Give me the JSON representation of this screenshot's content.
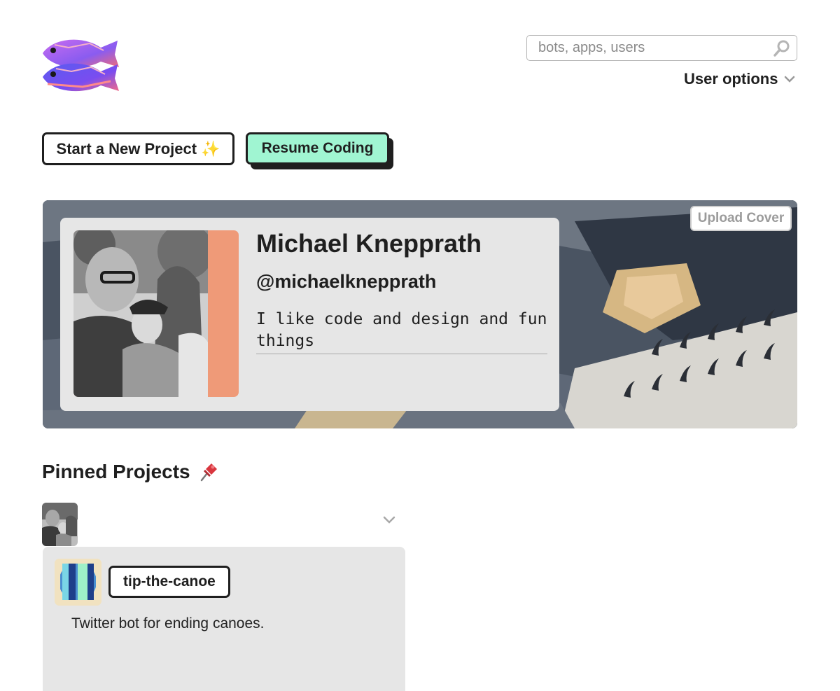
{
  "header": {
    "logo_icon": "fish-logo-icon",
    "search": {
      "placeholder": "bots, apps, users",
      "value": "",
      "icon": "search-icon"
    },
    "user_options_label": "User options",
    "user_options_icon": "chevron-down-icon"
  },
  "actions": {
    "new_project_label": "Start a New Project",
    "new_project_emoji": "✨",
    "resume_label": "Resume Coding",
    "resume_color": "#a0f5d2"
  },
  "profile": {
    "upload_cover_label": "Upload Cover",
    "name": "Michael Knepprath",
    "handle": "@michaelknepprath",
    "bio": "I like code and design and fun things",
    "avatar_frame_color": "#ef9a78"
  },
  "pinned": {
    "title": "Pinned Projects",
    "title_icon": "pushpin-icon",
    "projects": [
      {
        "name": "tip-the-canoe",
        "description": "Twitter bot for ending canoes."
      }
    ]
  }
}
